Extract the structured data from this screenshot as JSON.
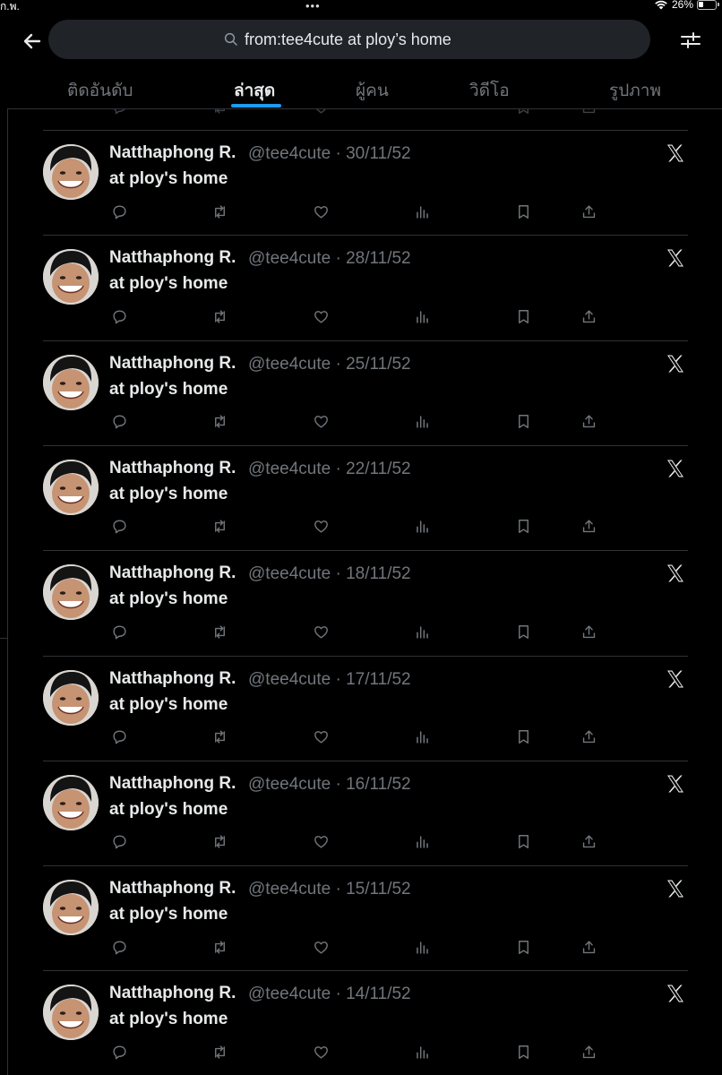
{
  "status_bar": {
    "left_text": "ก.พ.",
    "dots": "•••",
    "battery_text": "26%"
  },
  "search": {
    "query": "from:tee4cute at ploy’s home"
  },
  "tabs": [
    {
      "label": "ติดอันดับ",
      "active": false
    },
    {
      "label": "ล่าสุด",
      "active": true
    },
    {
      "label": "ผู้คน",
      "active": false
    },
    {
      "label": "วิดีโอ",
      "active": false
    },
    {
      "label": "รูปภาพ",
      "active": false
    }
  ],
  "colors": {
    "background": "#000000",
    "accent": "#1d9bf0",
    "muted": "#71767b",
    "text": "#e7e9ea",
    "divider": "#2f3336"
  },
  "icons": [
    "back-arrow-icon",
    "search-icon",
    "filter-sliders-icon",
    "x-logo-icon",
    "reply-icon",
    "retweet-icon",
    "like-icon",
    "views-icon",
    "bookmark-icon",
    "share-icon"
  ],
  "tweets": [
    {
      "name": "Natthaphong R.",
      "handle": "@tee4cute",
      "date": "30/11/52",
      "text": "at ploy's home"
    },
    {
      "name": "Natthaphong R.",
      "handle": "@tee4cute",
      "date": "28/11/52",
      "text": "at ploy's home"
    },
    {
      "name": "Natthaphong R.",
      "handle": "@tee4cute",
      "date": "25/11/52",
      "text": "at ploy's home"
    },
    {
      "name": "Natthaphong R.",
      "handle": "@tee4cute",
      "date": "22/11/52",
      "text": "at ploy's home"
    },
    {
      "name": "Natthaphong R.",
      "handle": "@tee4cute",
      "date": "18/11/52",
      "text": "at ploy's home"
    },
    {
      "name": "Natthaphong R.",
      "handle": "@tee4cute",
      "date": "17/11/52",
      "text": "at ploy's home"
    },
    {
      "name": "Natthaphong R.",
      "handle": "@tee4cute",
      "date": "16/11/52",
      "text": "at ploy's home"
    },
    {
      "name": "Natthaphong R.",
      "handle": "@tee4cute",
      "date": "15/11/52",
      "text": "at ploy's home"
    },
    {
      "name": "Natthaphong R.",
      "handle": "@tee4cute",
      "date": "14/11/52",
      "text": "at ploy's home"
    }
  ]
}
